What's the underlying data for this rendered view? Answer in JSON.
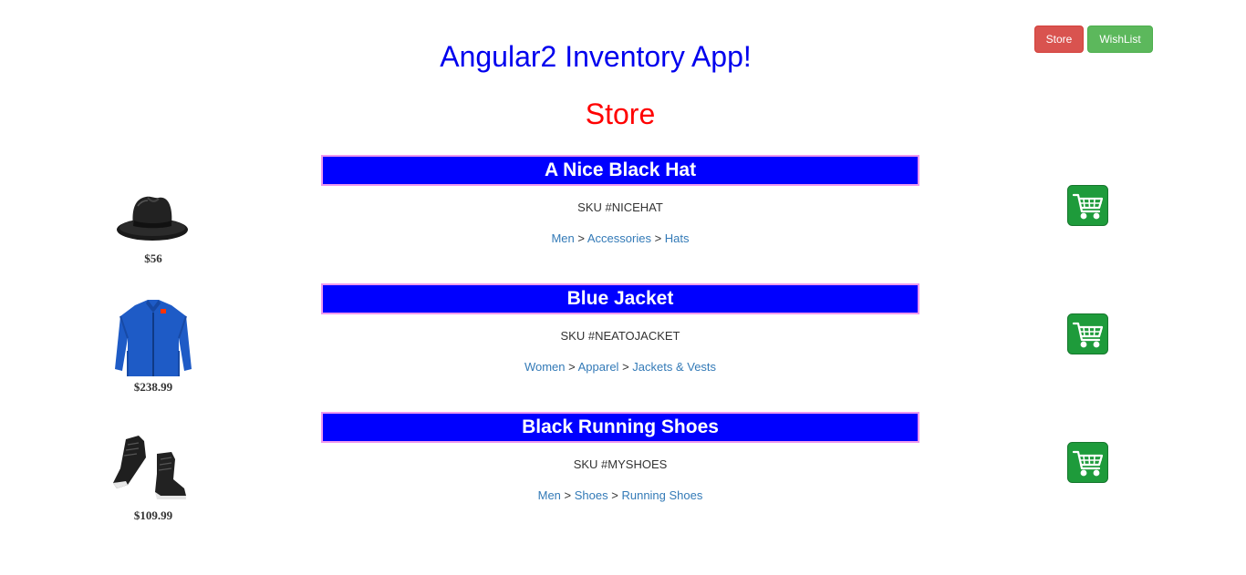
{
  "nav": {
    "store_label": "Store",
    "wishlist_label": "WishList"
  },
  "header": {
    "app_title": "Angular2 Inventory App!",
    "section_title": "Store"
  },
  "products": [
    {
      "name": "A Nice Black Hat",
      "sku": "SKU #NICEHAT",
      "price": "$56",
      "image_icon": "black-hat-image",
      "categories": [
        "Men",
        "Accessories",
        "Hats"
      ]
    },
    {
      "name": "Blue Jacket",
      "sku": "SKU #NEATOJACKET",
      "price": "$238.99",
      "image_icon": "blue-jacket-image",
      "categories": [
        "Women",
        "Apparel",
        "Jackets & Vests"
      ]
    },
    {
      "name": "Black Running Shoes",
      "sku": "SKU #MYSHOES",
      "price": "$109.99",
      "image_icon": "black-shoes-image",
      "categories": [
        "Men",
        "Shoes",
        "Running Shoes"
      ]
    }
  ],
  "crumb_separator": ">",
  "colors": {
    "title": "#0000ee",
    "section": "#ff0000",
    "name_bar": "#0000ff",
    "name_bar_border": "#ee99ee",
    "link": "#337ab7",
    "store_button": "#d9534f",
    "wishlist_button": "#5cb85c",
    "cart_button": "#1e9b3b"
  }
}
